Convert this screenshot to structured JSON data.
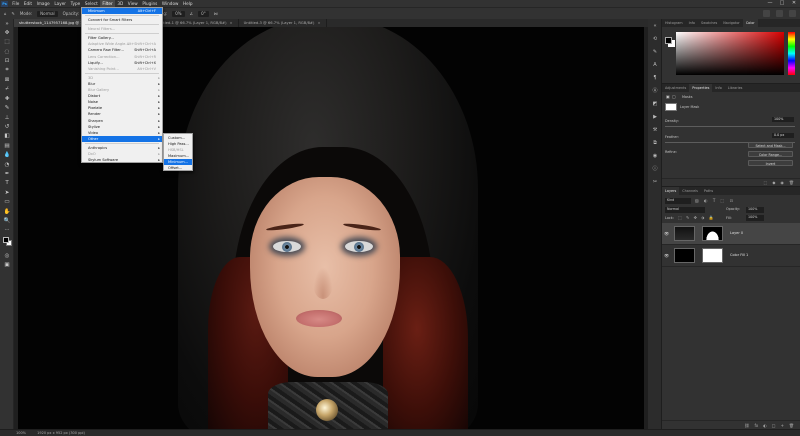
{
  "menubar": {
    "logo": "Ps",
    "items": [
      "File",
      "Edit",
      "Image",
      "Layer",
      "Type",
      "Select",
      "Filter",
      "3D",
      "View",
      "Plugins",
      "Window",
      "Help"
    ],
    "active": "Filter",
    "window_controls": [
      "—",
      "□",
      "✕"
    ]
  },
  "options": {
    "mode_label": "Mode:",
    "mode_value": "Normal",
    "opacity_label": "Opacity:",
    "opacity_value": "100%",
    "flow_label": "Flow:",
    "flow_value": "100%",
    "smoothing_label": "Smoothing:",
    "smoothing_value": "0%",
    "angle_value": "0°"
  },
  "tabs": [
    {
      "label": "shutterstock_1147957168.jpg @ 100% (Layer 0, Layer Mask/8) *",
      "close": "×"
    },
    {
      "label": "Untitled-1 @ 66.7% (Layer 1, RGB/8#)",
      "close": "×"
    },
    {
      "label": "Untitled-3 @ 66.7% (Layer 1, RGB/8#)",
      "close": "×"
    }
  ],
  "filter_menu": {
    "items": [
      {
        "label": "Minimum",
        "shortcut": "Alt+Ctrl+F",
        "highlighted": true
      },
      {
        "sep": true
      },
      {
        "label": "Convert for Smart Filters"
      },
      {
        "sep": true
      },
      {
        "label": "Neural Filters...",
        "disabled": true
      },
      {
        "sep": true
      },
      {
        "label": "Filter Gallery..."
      },
      {
        "label": "Adaptive Wide Angle...",
        "shortcut": "Alt+Shift+Ctrl+A",
        "disabled": true
      },
      {
        "label": "Camera Raw Filter...",
        "shortcut": "Shift+Ctrl+A"
      },
      {
        "label": "Lens Correction...",
        "shortcut": "Shift+Ctrl+R",
        "disabled": true
      },
      {
        "label": "Liquify...",
        "shortcut": "Shift+Ctrl+X"
      },
      {
        "label": "Vanishing Point...",
        "shortcut": "Alt+Ctrl+V",
        "disabled": true
      },
      {
        "sep": true
      },
      {
        "label": "3D",
        "submenu": true,
        "disabled": true
      },
      {
        "label": "Blur",
        "submenu": true
      },
      {
        "label": "Blur Gallery",
        "submenu": true,
        "disabled": true
      },
      {
        "label": "Distort",
        "submenu": true
      },
      {
        "label": "Noise",
        "submenu": true
      },
      {
        "label": "Pixelate",
        "submenu": true
      },
      {
        "label": "Render",
        "submenu": true
      },
      {
        "label": "Sharpen",
        "submenu": true
      },
      {
        "label": "Stylize",
        "submenu": true
      },
      {
        "label": "Video",
        "submenu": true
      },
      {
        "label": "Other",
        "submenu": true,
        "highlighted": true
      },
      {
        "sep": true
      },
      {
        "label": "Anthropics",
        "submenu": true
      },
      {
        "label": "DxO",
        "submenu": true,
        "disabled": true
      },
      {
        "label": "Skylum Software",
        "submenu": true
      }
    ]
  },
  "other_menu": {
    "items": [
      {
        "label": "Custom..."
      },
      {
        "label": "High Pass..."
      },
      {
        "label": "HSB/HSL",
        "disabled": true
      },
      {
        "label": "Maximum..."
      },
      {
        "label": "Minimum...",
        "highlighted": true
      },
      {
        "label": "Offset..."
      }
    ]
  },
  "color_panel": {
    "tabs": [
      "Histogram",
      "Info",
      "Swatches",
      "Navigator",
      "Color"
    ],
    "active": "Color"
  },
  "properties_panel": {
    "tabs": [
      "Adjustments",
      "Properties",
      "Info",
      "Libraries"
    ],
    "active": "Properties",
    "masks_label": "Masks",
    "layer_mask_label": "Layer Mask",
    "density_label": "Density:",
    "density_value": "100%",
    "feather_label": "Feather:",
    "feather_value": "0.0 px",
    "refine_label": "Refine:",
    "buttons": [
      "Select and Mask...",
      "Color Range...",
      "Invert"
    ]
  },
  "layers_panel": {
    "tabs": [
      "Layers",
      "Channels",
      "Paths"
    ],
    "active": "Layers",
    "kind_label": "Kind",
    "blend_mode": "Normal",
    "opacity_label": "Opacity:",
    "opacity_value": "100%",
    "lock_label": "Lock:",
    "fill_label": "Fill:",
    "fill_value": "100%",
    "layers": [
      {
        "name": "Layer 0",
        "selected": true
      },
      {
        "name": "Color Fill 1",
        "selected": false
      }
    ],
    "footer_icons": [
      "fx",
      "◐",
      "□",
      "+",
      "🗑"
    ]
  },
  "status": {
    "zoom": "100%",
    "doc_size": "1920 px x 952 px (300 ppi)"
  },
  "colors": {
    "accent": "#1473e6",
    "app_bg": "#323232"
  }
}
